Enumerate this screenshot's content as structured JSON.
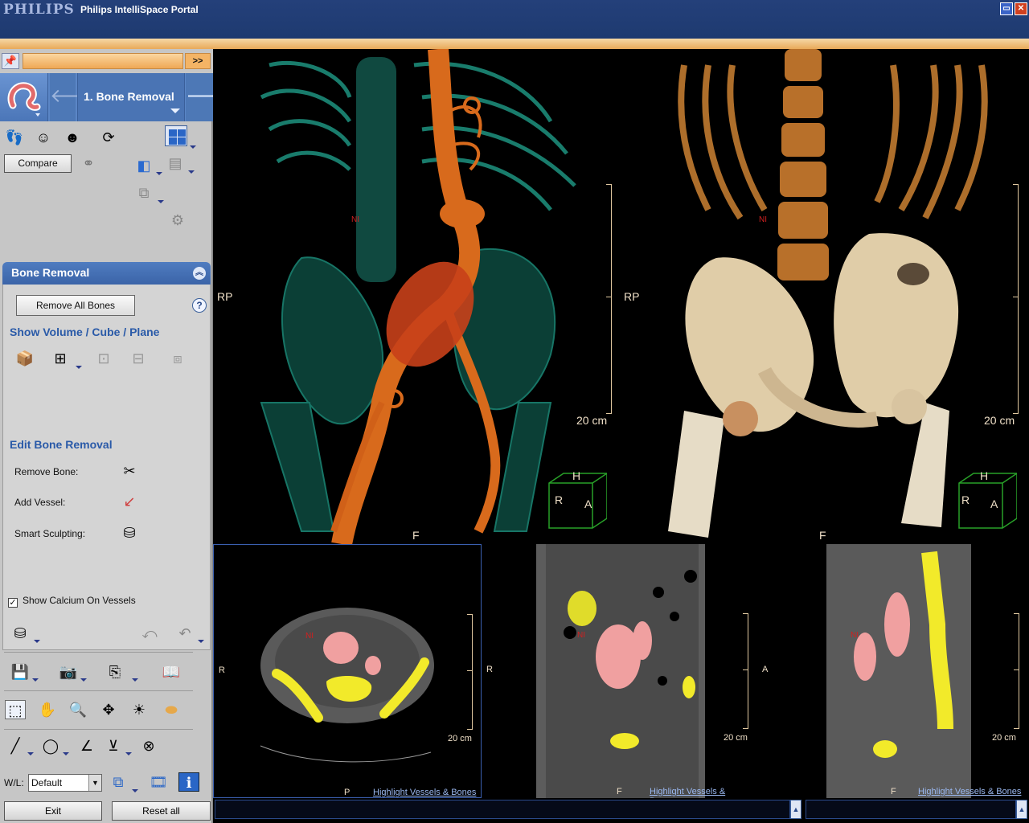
{
  "window": {
    "brand": "PHILIPS",
    "title": "Philips IntelliSpace Portal",
    "minimize_glyph": "▭",
    "close_glyph": "✕"
  },
  "panel": {
    "pin_icon": "pin-icon",
    "expand_label": ">>",
    "step": {
      "back_glyph": "🡐",
      "title": "1. Bone Removal",
      "next_glyph": "🡒"
    },
    "compare_label": "Compare",
    "bone_removal": {
      "header": "Bone Removal",
      "collapse_glyph": "︽",
      "remove_all_label": "Remove All Bones",
      "help_glyph": "?",
      "show_section": "Show Volume / Cube / Plane",
      "edit_section": "Edit Bone Removal",
      "remove_bone_label": "Remove Bone:",
      "add_vessel_label": "Add Vessel:",
      "smart_sculpting_label": "Smart Sculpting:",
      "show_calcium_label": "Show Calcium On Vessels",
      "show_calcium_checked": true,
      "check_glyph": "✓"
    },
    "wl_label": "W/L:",
    "wl_value": "Default",
    "wl_arrow": "▼",
    "exit_label": "Exit",
    "reset_label": "Reset all"
  },
  "viewports": {
    "vr_left": {
      "left_label": "RP",
      "bottom_label": "F",
      "scale_label": "20 cm",
      "cube_h": "H",
      "cube_r": "R",
      "cube_a": "A",
      "marker": "NI"
    },
    "vr_right": {
      "left_label": "RP",
      "bottom_label": "F",
      "scale_label": "20 cm",
      "cube_h": "H",
      "cube_r": "R",
      "cube_a": "A",
      "marker": "NI"
    },
    "axial": {
      "left_label": "R",
      "bottom_label": "P",
      "scale_label": "20 cm",
      "link": "Highlight Vessels & Bones",
      "marker": "NI"
    },
    "coronal": {
      "left_label": "R",
      "bottom_label": "F",
      "scale_label": "20 cm",
      "link": "Highlight Vessels & Bones",
      "marker": "NI"
    },
    "sagittal": {
      "left_label": "A",
      "bottom_label": "F",
      "scale_label": "20 cm",
      "link": "Highlight Vessels & Bones",
      "marker": "NI"
    }
  },
  "status": {
    "up_glyph": "▲"
  },
  "colors": {
    "title_bar": "#1e3a70",
    "accent_orange": "#efa855",
    "step_blue": "#4a74b4",
    "vessel": "#d86a1c",
    "bone_green": "#1c8a78",
    "bone_white": "#e8dcc4",
    "highlight_yellow": "#f2ea2a",
    "highlight_pink": "#f0a0a0"
  }
}
